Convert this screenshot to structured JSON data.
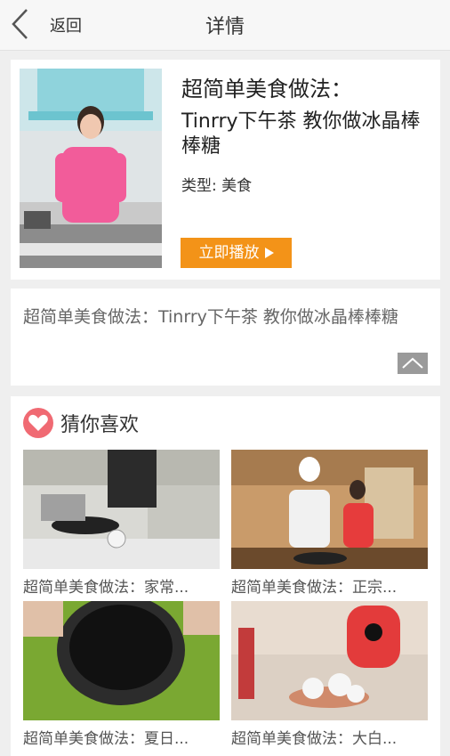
{
  "header": {
    "back_label": "返回",
    "title": "详情"
  },
  "video": {
    "title": "超简单美食做法：",
    "subtitle": "Tinrry下午茶 教你做冰晶棒棒糖",
    "type_line": "类型:  美食",
    "play_label": "立即播放"
  },
  "description": {
    "text": "超简单美食做法：Tinrry下午茶 教你做冰晶棒棒糖"
  },
  "recommendations": {
    "section_title": "猜你喜欢",
    "items": [
      {
        "caption": "超简单美食做法：家常..."
      },
      {
        "caption": "超简单美食做法：正宗..."
      },
      {
        "caption": "超简单美食做法：夏日..."
      },
      {
        "caption": "超简单美食做法：大白..."
      }
    ]
  },
  "colors": {
    "accent": "#f39318",
    "heart": "#f06a73",
    "background": "#efefef"
  }
}
